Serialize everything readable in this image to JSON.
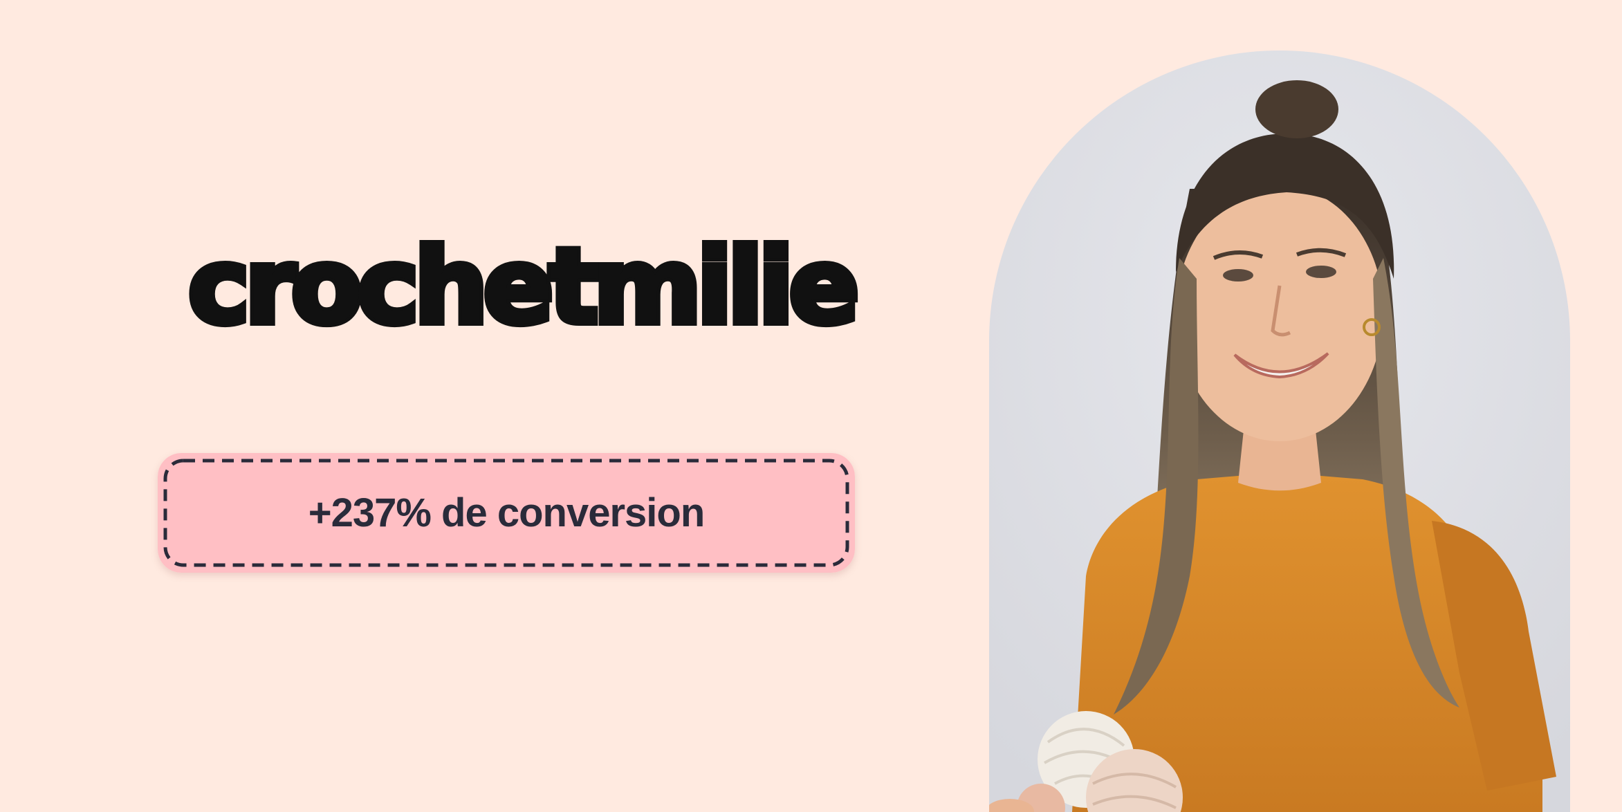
{
  "brand": {
    "name": "crochetmilie"
  },
  "badge": {
    "text": "+237% de conversion",
    "fill_color": "#FFBFC4",
    "border_color": "#2A2B3A"
  },
  "colors": {
    "background": "#FFEAE0",
    "logo": "#111111",
    "photo_backdrop": "#DCDDE3",
    "sweater": "#D98A2A"
  },
  "portrait": {
    "icon": "woman-holding-yarn-photo"
  }
}
